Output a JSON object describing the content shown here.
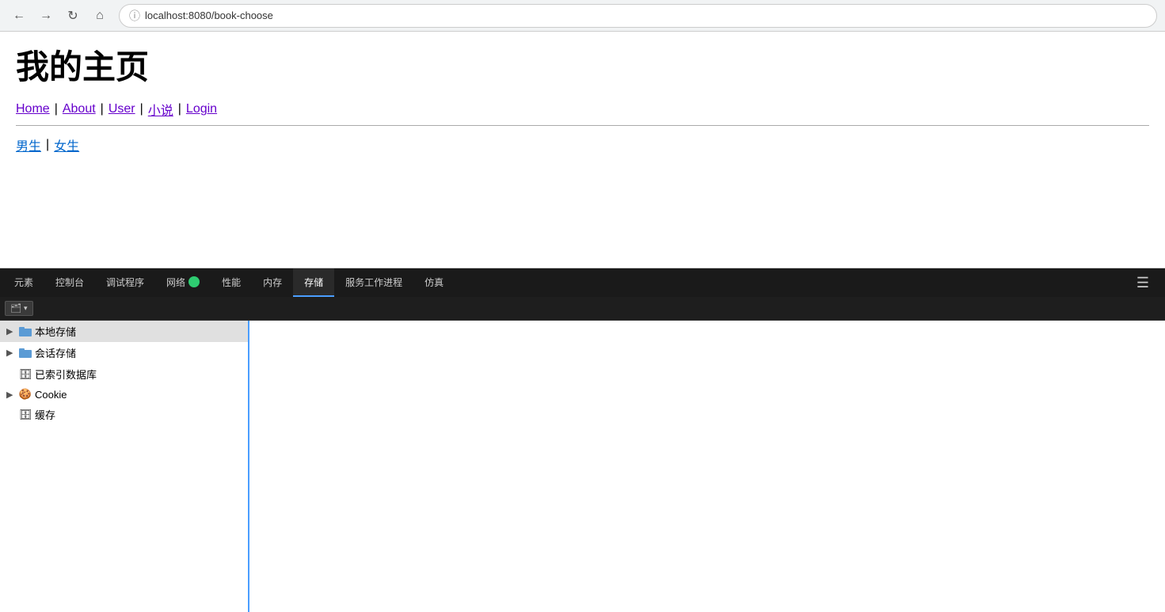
{
  "browser": {
    "url": "localhost:8080/book-choose",
    "back_disabled": false,
    "forward_disabled": false
  },
  "page": {
    "title": "我的主页",
    "nav": {
      "links": [
        {
          "label": "Home",
          "href": "#"
        },
        {
          "label": "About",
          "href": "#"
        },
        {
          "label": "User",
          "href": "#"
        },
        {
          "label": "小说",
          "href": "#"
        },
        {
          "label": "Login",
          "href": "#"
        }
      ]
    },
    "sub_nav": {
      "links": [
        {
          "label": "男生",
          "href": "#"
        },
        {
          "label": "女生",
          "href": "#"
        }
      ]
    }
  },
  "devtools": {
    "tabs": [
      {
        "label": "元素",
        "active": false
      },
      {
        "label": "控制台",
        "active": false
      },
      {
        "label": "调试程序",
        "active": false
      },
      {
        "label": "网络",
        "active": false,
        "has_icon": true
      },
      {
        "label": "性能",
        "active": false
      },
      {
        "label": "内存",
        "active": false
      },
      {
        "label": "存储",
        "active": true
      },
      {
        "label": "服务工作进程",
        "active": false
      },
      {
        "label": "仿真",
        "active": false
      }
    ],
    "menu_icon": "☰",
    "toolbar": {
      "button_label": "🗂"
    },
    "storage": {
      "items": [
        {
          "id": "local-storage",
          "label": "本地存储",
          "expandable": true,
          "expanded": false,
          "icon": "folder",
          "selected": true
        },
        {
          "id": "session-storage",
          "label": "会话存储",
          "expandable": true,
          "expanded": false,
          "icon": "folder"
        },
        {
          "id": "indexed-db",
          "label": "已索引数据库",
          "expandable": false,
          "icon": "db"
        },
        {
          "id": "cookie",
          "label": "Cookie",
          "expandable": true,
          "expanded": false,
          "icon": "cookie"
        },
        {
          "id": "cache",
          "label": "缓存",
          "expandable": false,
          "icon": "db"
        }
      ]
    }
  }
}
